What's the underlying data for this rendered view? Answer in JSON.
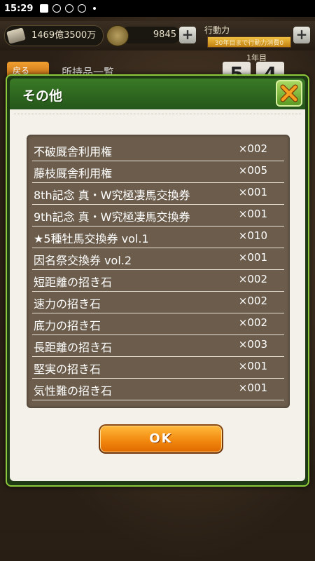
{
  "status_bar": {
    "time": "15:29",
    "icons": [
      "image-icon",
      "smiley-icon",
      "app-icon",
      "app-icon-2",
      "dot-icon"
    ]
  },
  "background": {
    "money": "1469億3500万",
    "horseshoe_count": "9845",
    "action_label": "行動力",
    "action_note": "30年目まで行動力消費0",
    "year": "1年目",
    "back_label": "戻る",
    "screen_title": "所持品一覧",
    "calendar": [
      "5",
      "4"
    ]
  },
  "dialog": {
    "title": "その他",
    "close_icon": "close-x-icon",
    "items": [
      {
        "name": "不破厩舎利用権",
        "qty": "×002"
      },
      {
        "name": "藤枝厩舎利用権",
        "qty": "×005"
      },
      {
        "name": "8th記念 真・W究極凄馬交換券",
        "qty": "×001"
      },
      {
        "name": "9th記念 真・W究極凄馬交換券",
        "qty": "×001"
      },
      {
        "name": "★5種牡馬交換券 vol.1",
        "qty": "×010"
      },
      {
        "name": "因名祭交換券 vol.2",
        "qty": "×001"
      },
      {
        "name": "短距離の招き石",
        "qty": "×002"
      },
      {
        "name": "速力の招き石",
        "qty": "×002"
      },
      {
        "name": "底力の招き石",
        "qty": "×002"
      },
      {
        "name": "長距離の招き石",
        "qty": "×003"
      },
      {
        "name": "堅実の招き石",
        "qty": "×001"
      },
      {
        "name": "気性難の招き石",
        "qty": "×001"
      }
    ],
    "ok_label": "OK"
  },
  "colors": {
    "header_green": "#2f6a20",
    "frame_green": "#8ec83c",
    "list_bg": "#6b5c4b",
    "ok_orange": "#f28a10"
  }
}
